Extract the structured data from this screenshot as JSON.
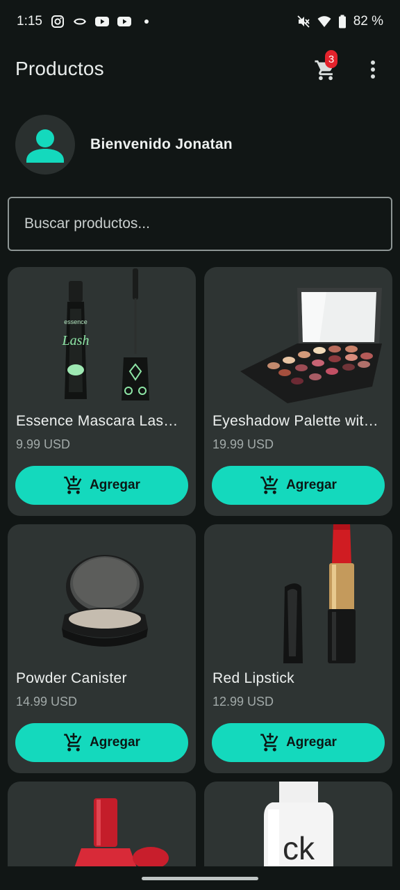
{
  "status_bar": {
    "time": "1:15",
    "battery": "82 %",
    "icons": [
      "instagram-icon",
      "eye-icon",
      "youtube-icon",
      "youtube-icon",
      "dot-icon",
      "mute-icon",
      "wifi-icon",
      "battery-icon"
    ]
  },
  "appbar": {
    "title": "Productos",
    "cart_count": "3"
  },
  "welcome": {
    "text": "Bienvenido Jonatan"
  },
  "search": {
    "placeholder": "Buscar productos..."
  },
  "products": [
    {
      "name": "Essence Mascara Lash Princess",
      "price": "9.99 USD",
      "button": "Agregar"
    },
    {
      "name": "Eyeshadow Palette with Mirror",
      "price": "19.99 USD",
      "button": "Agregar"
    },
    {
      "name": "Powder Canister",
      "price": "14.99 USD",
      "button": "Agregar"
    },
    {
      "name": "Red Lipstick",
      "price": "12.99 USD",
      "button": "Agregar"
    }
  ],
  "colors": {
    "accent": "#14d9bd",
    "background": "#111615",
    "card": "#2e3433",
    "badge": "#e4232c"
  }
}
